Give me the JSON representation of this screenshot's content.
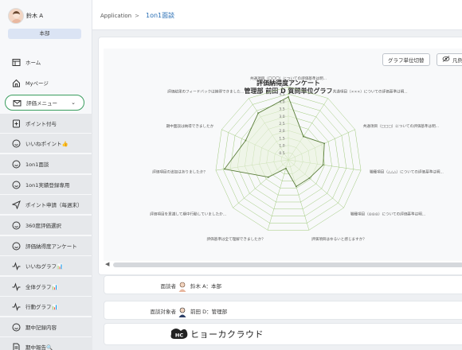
{
  "user": {
    "name": "鈴木 A",
    "department": "本部"
  },
  "sidebar": {
    "items": [
      {
        "label": "ホーム",
        "icon": "home-icon"
      },
      {
        "label": "Myページ",
        "icon": "house-icon"
      },
      {
        "label": "評価メニュー",
        "icon": "mail-icon",
        "active": true
      },
      {
        "label": "ポイント付与",
        "icon": "point-plus-icon"
      },
      {
        "label": "いいねポイント👍",
        "icon": "smile-icon"
      },
      {
        "label": "1on1面談",
        "icon": "smile-icon"
      },
      {
        "label": "1on1実績登録専用",
        "icon": "smile-icon"
      },
      {
        "label": "ポイント申請（每週末）",
        "icon": "send-icon"
      },
      {
        "label": "360度評価選択",
        "icon": "smile-icon"
      },
      {
        "label": "評価納得度アンケート",
        "icon": "smile-icon"
      },
      {
        "label": "いいねグラフ📊",
        "icon": "pulse-icon"
      },
      {
        "label": "全体グラフ📊",
        "icon": "pulse-icon"
      },
      {
        "label": "行動グラフ📊",
        "icon": "pulse-icon"
      },
      {
        "label": "期中記録内容",
        "icon": "smile-icon"
      },
      {
        "label": "期中報告🔍",
        "icon": "document-icon"
      }
    ]
  },
  "breadcrumb": {
    "root": "Application",
    "separator": ">",
    "current": "1on1面談"
  },
  "toolbar": {
    "graph_toggle": "グラフ単位切替",
    "legend": "凡例"
  },
  "chart_data": {
    "type": "radar",
    "title": "評価納得度アンケート",
    "subtitle": "管理部 前田 D 質問単位グラフ",
    "ticks": [
      "0.5",
      "1.0",
      "1.5",
      "2.0",
      "2.5",
      "3.0",
      "3.5",
      "4.0",
      "4.5",
      "5"
    ],
    "rmax": 5,
    "categories": [
      "共通項目（〇〇〇）についての評価基準は明...",
      "共通項目（×××）についての評価基準は明...",
      "共通項目（□□□）についての評価基準は明...",
      "職種項目（△△△）についての評価基準は明...",
      "職種項目（◎◎◎）についての評価基準は明...",
      "評価項目はゆるいと感じますか？",
      "評価基準は全て理解できましたか？",
      "評価項目を意識して期中行動していましたか...",
      "評価項目の追加はありましたか？",
      "期中面談は納得できましたか",
      "評価結果のフィードバックは納得できました..."
    ],
    "values": [
      4.3,
      1.9,
      2.7,
      2.4,
      1.9,
      1.9,
      0.6,
      1.8,
      4.4,
      3.2,
      3.8
    ],
    "color": "#5a7d3a",
    "fill": "#e9f2dc",
    "grid_color": "#9fc97b"
  },
  "info": {
    "interviewer_label": "面談者",
    "interviewer_value": "鈴木 A：本部",
    "target_label": "面談対象者",
    "target_value": "前田 D：管理部"
  },
  "logo": {
    "text": "ヒョーカクラウド",
    "mark": "HC"
  }
}
